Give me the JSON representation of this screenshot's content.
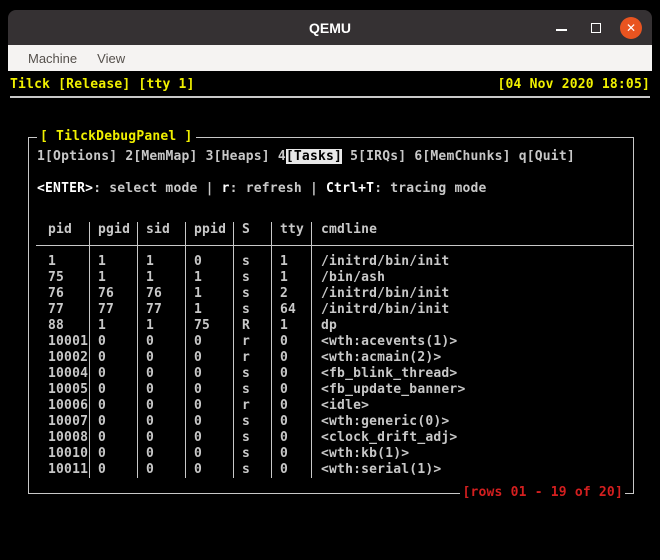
{
  "window": {
    "title": "QEMU",
    "menu_items": [
      "Machine",
      "View"
    ],
    "controls": [
      "minimize",
      "maximize",
      "close"
    ]
  },
  "colors": {
    "titlebar_bg": "#353133",
    "menubar_bg": "#f5f3f2",
    "close_button": "#e95420",
    "terminal_fg": "#c8c8c8",
    "terminal_yellow": "#f0f000",
    "terminal_red": "#d41f1f",
    "active_tab_bg": "#e8e8e8"
  },
  "terminal": {
    "status_left": "Tilck [Release] [tty 1]",
    "status_right": "[04 Nov 2020 18:05]"
  },
  "panel": {
    "title": "[ TilckDebugPanel ]",
    "tabs": [
      {
        "key": "1",
        "label": "[Options]",
        "active": false
      },
      {
        "key": "2",
        "label": "[MemMap]",
        "active": false
      },
      {
        "key": "3",
        "label": "[Heaps]",
        "active": false
      },
      {
        "key": "4",
        "label": "[Tasks]",
        "active": true
      },
      {
        "key": "5",
        "label": "[IRQs]",
        "active": false
      },
      {
        "key": "6",
        "label": "[MemChunks]",
        "active": false
      },
      {
        "key": "q",
        "label": "[Quit]",
        "active": false
      }
    ],
    "help_separator": "|",
    "help": [
      {
        "key": "<ENTER>",
        "desc": ": select mode"
      },
      {
        "key": "r",
        "desc": ": refresh"
      },
      {
        "key": "Ctrl+T",
        "desc": ": tracing mode"
      }
    ],
    "table": {
      "columns": [
        "pid",
        "pgid",
        "sid",
        "ppid",
        "S",
        "tty",
        "cmdline"
      ],
      "rows": [
        [
          "1",
          "1",
          "1",
          "0",
          "s",
          "1",
          "/initrd/bin/init"
        ],
        [
          "75",
          "1",
          "1",
          "1",
          "s",
          "1",
          "/bin/ash"
        ],
        [
          "76",
          "76",
          "76",
          "1",
          "s",
          "2",
          "/initrd/bin/init"
        ],
        [
          "77",
          "77",
          "77",
          "1",
          "s",
          "64",
          "/initrd/bin/init"
        ],
        [
          "88",
          "1",
          "1",
          "75",
          "R",
          "1",
          "dp"
        ],
        [
          "10001",
          "0",
          "0",
          "0",
          "r",
          "0",
          "<wth:acevents(1)>"
        ],
        [
          "10002",
          "0",
          "0",
          "0",
          "r",
          "0",
          "<wth:acmain(2)>"
        ],
        [
          "10004",
          "0",
          "0",
          "0",
          "s",
          "0",
          "<fb_blink_thread>"
        ],
        [
          "10005",
          "0",
          "0",
          "0",
          "s",
          "0",
          "<fb_update_banner>"
        ],
        [
          "10006",
          "0",
          "0",
          "0",
          "r",
          "0",
          "<idle>"
        ],
        [
          "10007",
          "0",
          "0",
          "0",
          "s",
          "0",
          "<wth:generic(0)>"
        ],
        [
          "10008",
          "0",
          "0",
          "0",
          "s",
          "0",
          "<clock_drift_adj>"
        ],
        [
          "10010",
          "0",
          "0",
          "0",
          "s",
          "0",
          "<wth:kb(1)>"
        ],
        [
          "10011",
          "0",
          "0",
          "0",
          "s",
          "0",
          "<wth:serial(1)>"
        ]
      ]
    },
    "rows_indicator": "[rows 01 - 19 of 20]"
  }
}
